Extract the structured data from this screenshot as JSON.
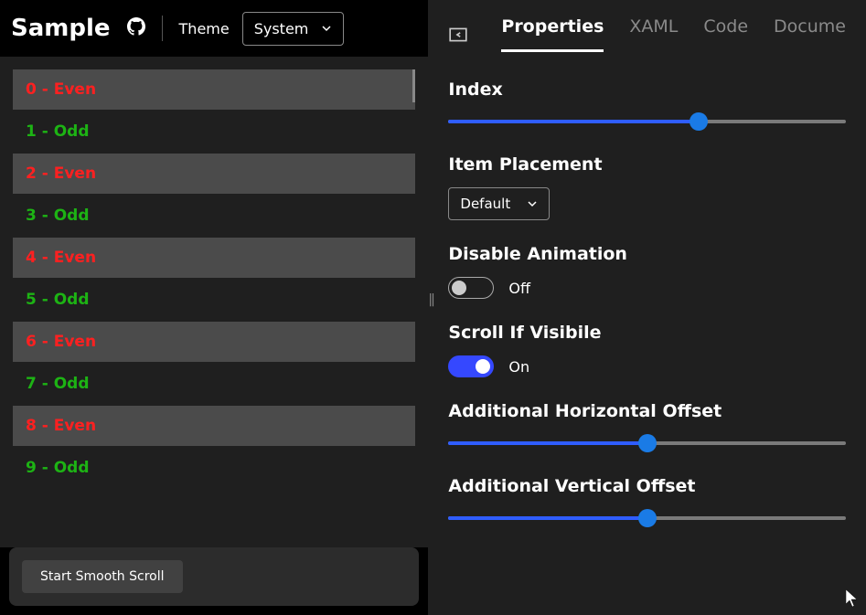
{
  "header": {
    "title": "Sample",
    "theme_label": "Theme",
    "theme_value": "System"
  },
  "list": {
    "items": [
      {
        "label": "0 - Even",
        "kind": "even"
      },
      {
        "label": "1 - Odd",
        "kind": "odd"
      },
      {
        "label": "2 - Even",
        "kind": "even"
      },
      {
        "label": "3 - Odd",
        "kind": "odd"
      },
      {
        "label": "4 - Even",
        "kind": "even"
      },
      {
        "label": "5 - Odd",
        "kind": "odd"
      },
      {
        "label": "6 - Even",
        "kind": "even"
      },
      {
        "label": "7 - Odd",
        "kind": "odd"
      },
      {
        "label": "8 - Even",
        "kind": "even"
      },
      {
        "label": "9 - Odd",
        "kind": "odd"
      }
    ]
  },
  "action": {
    "button_label": "Start Smooth Scroll"
  },
  "tabs": {
    "items": [
      {
        "label": "Properties",
        "active": true
      },
      {
        "label": "XAML",
        "active": false
      },
      {
        "label": "Code",
        "active": false
      },
      {
        "label": "Docume",
        "active": false
      }
    ]
  },
  "props": {
    "index": {
      "label": "Index",
      "pct": 63
    },
    "item_placement": {
      "label": "Item Placement",
      "value": "Default"
    },
    "disable_animation": {
      "label": "Disable Animation",
      "value": "Off",
      "on": false
    },
    "scroll_if_visible": {
      "label": "Scroll If Visibile",
      "value": "On",
      "on": true
    },
    "horizontal_offset": {
      "label": "Additional Horizontal Offset",
      "pct": 50
    },
    "vertical_offset": {
      "label": "Additional Vertical Offset",
      "pct": 50
    }
  }
}
